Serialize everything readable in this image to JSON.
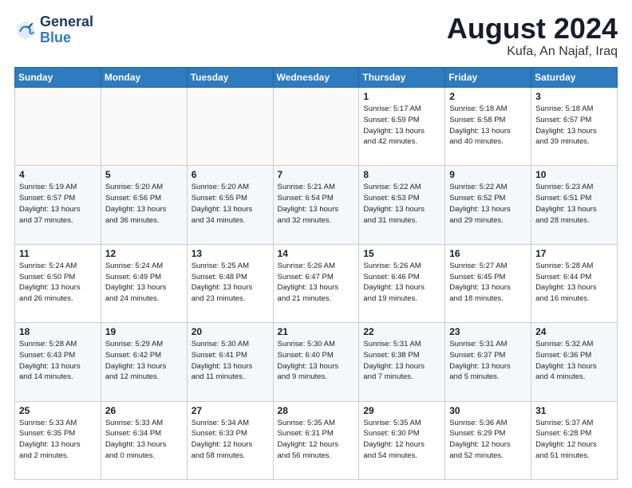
{
  "header": {
    "logo_line1": "General",
    "logo_line2": "Blue",
    "month_title": "August 2024",
    "location": "Kufa, An Najaf, Iraq"
  },
  "weekdays": [
    "Sunday",
    "Monday",
    "Tuesday",
    "Wednesday",
    "Thursday",
    "Friday",
    "Saturday"
  ],
  "weeks": [
    [
      {
        "day": "",
        "info": ""
      },
      {
        "day": "",
        "info": ""
      },
      {
        "day": "",
        "info": ""
      },
      {
        "day": "",
        "info": ""
      },
      {
        "day": "1",
        "info": "Sunrise: 5:17 AM\nSunset: 6:59 PM\nDaylight: 13 hours\nand 42 minutes."
      },
      {
        "day": "2",
        "info": "Sunrise: 5:18 AM\nSunset: 6:58 PM\nDaylight: 13 hours\nand 40 minutes."
      },
      {
        "day": "3",
        "info": "Sunrise: 5:18 AM\nSunset: 6:57 PM\nDaylight: 13 hours\nand 39 minutes."
      }
    ],
    [
      {
        "day": "4",
        "info": "Sunrise: 5:19 AM\nSunset: 6:57 PM\nDaylight: 13 hours\nand 37 minutes."
      },
      {
        "day": "5",
        "info": "Sunrise: 5:20 AM\nSunset: 6:56 PM\nDaylight: 13 hours\nand 36 minutes."
      },
      {
        "day": "6",
        "info": "Sunrise: 5:20 AM\nSunset: 6:55 PM\nDaylight: 13 hours\nand 34 minutes."
      },
      {
        "day": "7",
        "info": "Sunrise: 5:21 AM\nSunset: 6:54 PM\nDaylight: 13 hours\nand 32 minutes."
      },
      {
        "day": "8",
        "info": "Sunrise: 5:22 AM\nSunset: 6:53 PM\nDaylight: 13 hours\nand 31 minutes."
      },
      {
        "day": "9",
        "info": "Sunrise: 5:22 AM\nSunset: 6:52 PM\nDaylight: 13 hours\nand 29 minutes."
      },
      {
        "day": "10",
        "info": "Sunrise: 5:23 AM\nSunset: 6:51 PM\nDaylight: 13 hours\nand 28 minutes."
      }
    ],
    [
      {
        "day": "11",
        "info": "Sunrise: 5:24 AM\nSunset: 6:50 PM\nDaylight: 13 hours\nand 26 minutes."
      },
      {
        "day": "12",
        "info": "Sunrise: 5:24 AM\nSunset: 6:49 PM\nDaylight: 13 hours\nand 24 minutes."
      },
      {
        "day": "13",
        "info": "Sunrise: 5:25 AM\nSunset: 6:48 PM\nDaylight: 13 hours\nand 23 minutes."
      },
      {
        "day": "14",
        "info": "Sunrise: 5:26 AM\nSunset: 6:47 PM\nDaylight: 13 hours\nand 21 minutes."
      },
      {
        "day": "15",
        "info": "Sunrise: 5:26 AM\nSunset: 6:46 PM\nDaylight: 13 hours\nand 19 minutes."
      },
      {
        "day": "16",
        "info": "Sunrise: 5:27 AM\nSunset: 6:45 PM\nDaylight: 13 hours\nand 18 minutes."
      },
      {
        "day": "17",
        "info": "Sunrise: 5:28 AM\nSunset: 6:44 PM\nDaylight: 13 hours\nand 16 minutes."
      }
    ],
    [
      {
        "day": "18",
        "info": "Sunrise: 5:28 AM\nSunset: 6:43 PM\nDaylight: 13 hours\nand 14 minutes."
      },
      {
        "day": "19",
        "info": "Sunrise: 5:29 AM\nSunset: 6:42 PM\nDaylight: 13 hours\nand 12 minutes."
      },
      {
        "day": "20",
        "info": "Sunrise: 5:30 AM\nSunset: 6:41 PM\nDaylight: 13 hours\nand 11 minutes."
      },
      {
        "day": "21",
        "info": "Sunrise: 5:30 AM\nSunset: 6:40 PM\nDaylight: 13 hours\nand 9 minutes."
      },
      {
        "day": "22",
        "info": "Sunrise: 5:31 AM\nSunset: 6:38 PM\nDaylight: 13 hours\nand 7 minutes."
      },
      {
        "day": "23",
        "info": "Sunrise: 5:31 AM\nSunset: 6:37 PM\nDaylight: 13 hours\nand 5 minutes."
      },
      {
        "day": "24",
        "info": "Sunrise: 5:32 AM\nSunset: 6:36 PM\nDaylight: 13 hours\nand 4 minutes."
      }
    ],
    [
      {
        "day": "25",
        "info": "Sunrise: 5:33 AM\nSunset: 6:35 PM\nDaylight: 13 hours\nand 2 minutes."
      },
      {
        "day": "26",
        "info": "Sunrise: 5:33 AM\nSunset: 6:34 PM\nDaylight: 13 hours\nand 0 minutes."
      },
      {
        "day": "27",
        "info": "Sunrise: 5:34 AM\nSunset: 6:33 PM\nDaylight: 12 hours\nand 58 minutes."
      },
      {
        "day": "28",
        "info": "Sunrise: 5:35 AM\nSunset: 6:31 PM\nDaylight: 12 hours\nand 56 minutes."
      },
      {
        "day": "29",
        "info": "Sunrise: 5:35 AM\nSunset: 6:30 PM\nDaylight: 12 hours\nand 54 minutes."
      },
      {
        "day": "30",
        "info": "Sunrise: 5:36 AM\nSunset: 6:29 PM\nDaylight: 12 hours\nand 52 minutes."
      },
      {
        "day": "31",
        "info": "Sunrise: 5:37 AM\nSunset: 6:28 PM\nDaylight: 12 hours\nand 51 minutes."
      }
    ]
  ]
}
